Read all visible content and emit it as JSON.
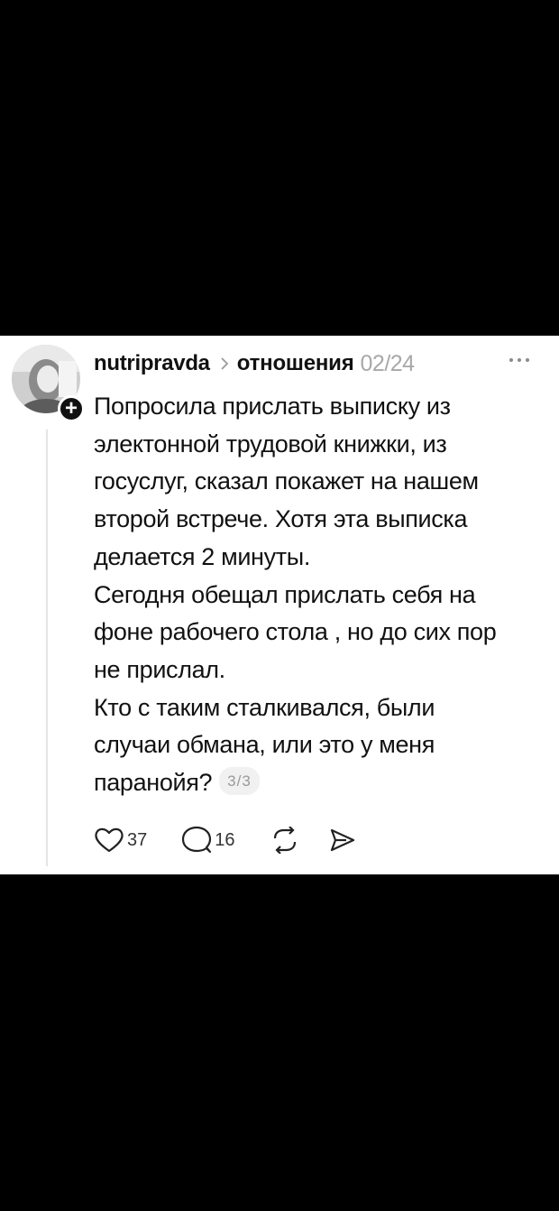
{
  "post": {
    "username": "nutripravda",
    "topic": "отношения",
    "date": "02/24",
    "lines": [
      "Попросила прислать выписку из",
      "электонной трудовой книжки, из",
      "госуслуг, сказал покажет на нашем",
      "второй встрече. Хотя эта выписка",
      "делается 2 минуты.",
      "Сегодня обещал прислать себя на",
      "фоне рабочего стола , но до сих пор",
      "не прислал.",
      "Кто с таким сталкивался, были",
      "случаи обмана, или это у меня",
      "паранойя?"
    ],
    "page_counter": "3/3",
    "likes": "37",
    "comments": "16"
  },
  "icons": {
    "more": "more-dots-icon",
    "like": "heart-icon",
    "comment": "comment-icon",
    "repost": "repost-icon",
    "share": "send-icon",
    "follow": "plus-icon"
  },
  "colors": {
    "background": "#000000",
    "card": "#ffffff",
    "text": "#111111",
    "muted": "#a8a8a8"
  }
}
